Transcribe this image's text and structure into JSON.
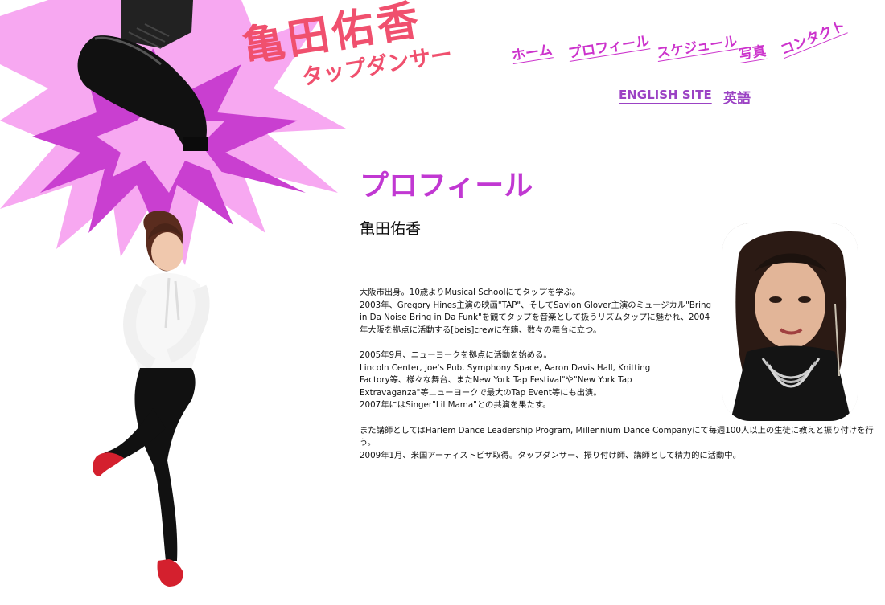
{
  "site": {
    "title_name": "亀田佑香",
    "title_sub": "タップダンサー"
  },
  "nav": {
    "items": [
      {
        "label": "ホーム"
      },
      {
        "label": "プロフィール"
      },
      {
        "label": "スケジュール"
      },
      {
        "label": "写真"
      },
      {
        "label": "コンタクト"
      }
    ],
    "english_site": "ENGLISH SITE",
    "english_ja": "英語"
  },
  "colors": {
    "title": "#f0506e",
    "nav": "#cc33cc",
    "heading": "#c138d2",
    "burst_light": "#f7a8f1",
    "burst_dark": "#c93fd0"
  },
  "main": {
    "heading": "プロフィール",
    "name": "亀田佑香",
    "bio": [
      "大阪市出身。10歳よりMusical Schoolにてタップを学ぶ。\n2003年、Gregory Hines主演の映画\"TAP\"、そしてSavion Glover主演のミュージカル\"Bring in Da Noise Bring in Da Funk\"を観てタップを音楽として扱うリズムタップに魅かれ、2004年大阪を拠点に活動する[beis]crewに在籍、数々の舞台に立つ。",
      "2005年9月、ニューヨークを拠点に活動を始める。\nLincoln Center, Joe's Pub, Symphony Space, Aaron Davis Hall, Knitting Factory等、様々な舞台、またNew York Tap Festival\"や\"New York Tap Extravaganza\"等ニューヨークで最大のTap Event等にも出演。\n2007年にはSinger\"Lil Mama\"との共演を果たす。",
      "また講師としてはHarlem Dance Leadership Program, Millennium Dance Companyにて毎週100人以上の生徒に教えと振り付けを行う。\n2009年1月、米国アーティストビザ取得。タップダンサー、振り付け師、講師として精力的に活動中。"
    ]
  }
}
